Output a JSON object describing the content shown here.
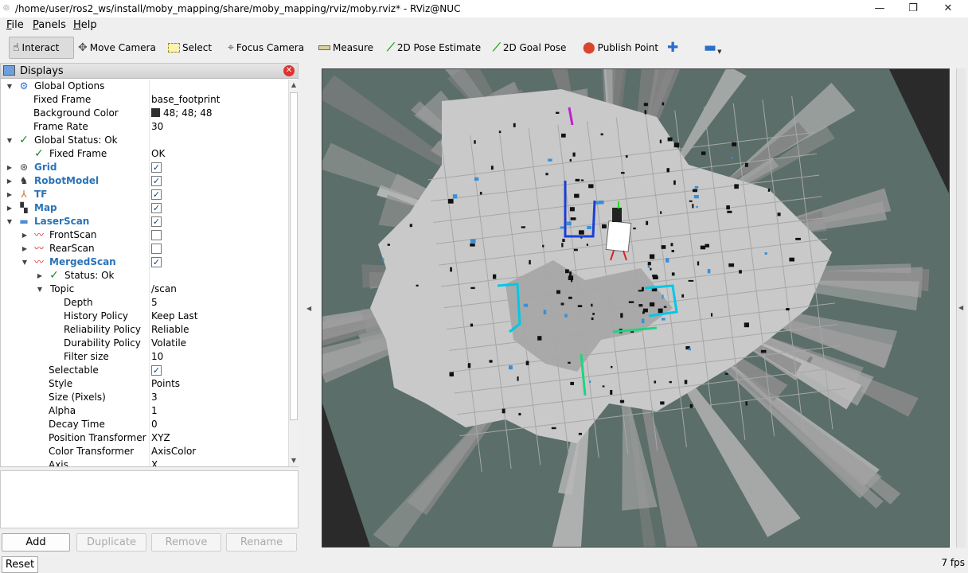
{
  "window": {
    "title": "/home/user/ros2_ws/install/moby_mapping/share/moby_mapping/rviz/moby.rviz* - RViz@NUC",
    "minimize": "—",
    "restore": "❐",
    "close": "✕"
  },
  "menu": {
    "file": {
      "underline": "F",
      "rest": "ile"
    },
    "panels": {
      "underline": "P",
      "rest": "anels"
    },
    "help": {
      "underline": "H",
      "rest": "elp"
    }
  },
  "toolbar": {
    "tools": [
      {
        "label": "Interact",
        "icon": "hand-icon",
        "active": true
      },
      {
        "label": "Move Camera",
        "icon": "move-camera-icon"
      },
      {
        "label": "Select",
        "icon": "select-icon"
      },
      {
        "label": "Focus Camera",
        "icon": "focus-camera-icon"
      },
      {
        "label": "Measure",
        "icon": "ruler-icon"
      },
      {
        "label": "2D Pose Estimate",
        "icon": "pose-estimate-arrow-icon",
        "color": "#1faa1f"
      },
      {
        "label": "2D Goal Pose",
        "icon": "goal-pose-arrow-icon",
        "color": "#1faa1f"
      },
      {
        "label": "Publish Point",
        "icon": "map-pin-icon",
        "color": "#d9462c"
      }
    ],
    "add_tool_icon": "plus-icon",
    "remove_tool_icon": "minus-icon"
  },
  "displays": {
    "title": "Displays",
    "close_icon": "close-icon",
    "rows": [
      {
        "depth": 0,
        "arrow": "down",
        "icon": "gear-icon",
        "label": "Global Options"
      },
      {
        "depth": 1,
        "label": "Fixed Frame",
        "value": "base_footprint"
      },
      {
        "depth": 1,
        "label": "Background Color",
        "value": "48; 48; 48",
        "swatch": "#303030"
      },
      {
        "depth": 1,
        "label": "Frame Rate",
        "value": "30"
      },
      {
        "depth": 0,
        "arrow": "down",
        "icon": "check-icon",
        "label": "Global Status: Ok"
      },
      {
        "depth": 1,
        "icon": "check-icon",
        "label": "Fixed Frame",
        "value": "OK"
      },
      {
        "depth": 0,
        "arrow": "right",
        "icon": "grid-icon",
        "label": "Grid",
        "plugin": true,
        "checked": true
      },
      {
        "depth": 0,
        "arrow": "right",
        "icon": "robot-icon",
        "label": "RobotModel",
        "plugin": true,
        "checked": true
      },
      {
        "depth": 0,
        "arrow": "right",
        "icon": "tf-axes-icon",
        "label": "TF",
        "plugin": true,
        "checked": true
      },
      {
        "depth": 0,
        "arrow": "right",
        "icon": "map-icon",
        "label": "Map",
        "plugin": true,
        "checked": true
      },
      {
        "depth": 0,
        "arrow": "down",
        "icon": "folder-icon",
        "label": "LaserScan",
        "plugin": true,
        "checked": true
      },
      {
        "depth": 1,
        "arrow": "right",
        "icon": "laser-icon",
        "label": "FrontScan",
        "checked": false
      },
      {
        "depth": 1,
        "arrow": "right",
        "icon": "laser-icon",
        "label": "RearScan",
        "checked": false
      },
      {
        "depth": 1,
        "arrow": "down",
        "icon": "laser-icon",
        "label": "MergedScan",
        "plugin": true,
        "checked": true
      },
      {
        "depth": 2,
        "arrow": "right",
        "icon": "check-icon",
        "label": "Status: Ok"
      },
      {
        "depth": 2,
        "arrow": "down",
        "label": "Topic",
        "value": "/scan"
      },
      {
        "depth": 3,
        "label": "Depth",
        "value": "5"
      },
      {
        "depth": 3,
        "label": "History Policy",
        "value": "Keep Last"
      },
      {
        "depth": 3,
        "label": "Reliability Policy",
        "value": "Reliable"
      },
      {
        "depth": 3,
        "label": "Durability Policy",
        "value": "Volatile"
      },
      {
        "depth": 3,
        "label": "Filter size",
        "value": "10"
      },
      {
        "depth": 2,
        "label": "Selectable",
        "checked": true
      },
      {
        "depth": 2,
        "label": "Style",
        "value": "Points"
      },
      {
        "depth": 2,
        "label": "Size (Pixels)",
        "value": "3"
      },
      {
        "depth": 2,
        "label": "Alpha",
        "value": "1"
      },
      {
        "depth": 2,
        "label": "Decay Time",
        "value": "0"
      },
      {
        "depth": 2,
        "label": "Position Transformer",
        "value": "XYZ"
      },
      {
        "depth": 2,
        "label": "Color Transformer",
        "value": "AxisColor"
      },
      {
        "depth": 2,
        "label": "Axis",
        "value": "X"
      }
    ]
  },
  "buttons": {
    "add": "Add",
    "duplicate": "Duplicate",
    "remove": "Remove",
    "rename": "Rename",
    "reset": "Reset"
  },
  "status": {
    "fps": "7 fps"
  },
  "viewport": {
    "background": "#5b6e69",
    "map_free": "#c9c9c9",
    "map_unknown_ray": "#8d8d8d",
    "grid": "#a7a7a7",
    "scan_colors": [
      "#00c8e6",
      "#1a3fd6",
      "#1fd480",
      "#c01fd0",
      "#2fd42f"
    ]
  }
}
